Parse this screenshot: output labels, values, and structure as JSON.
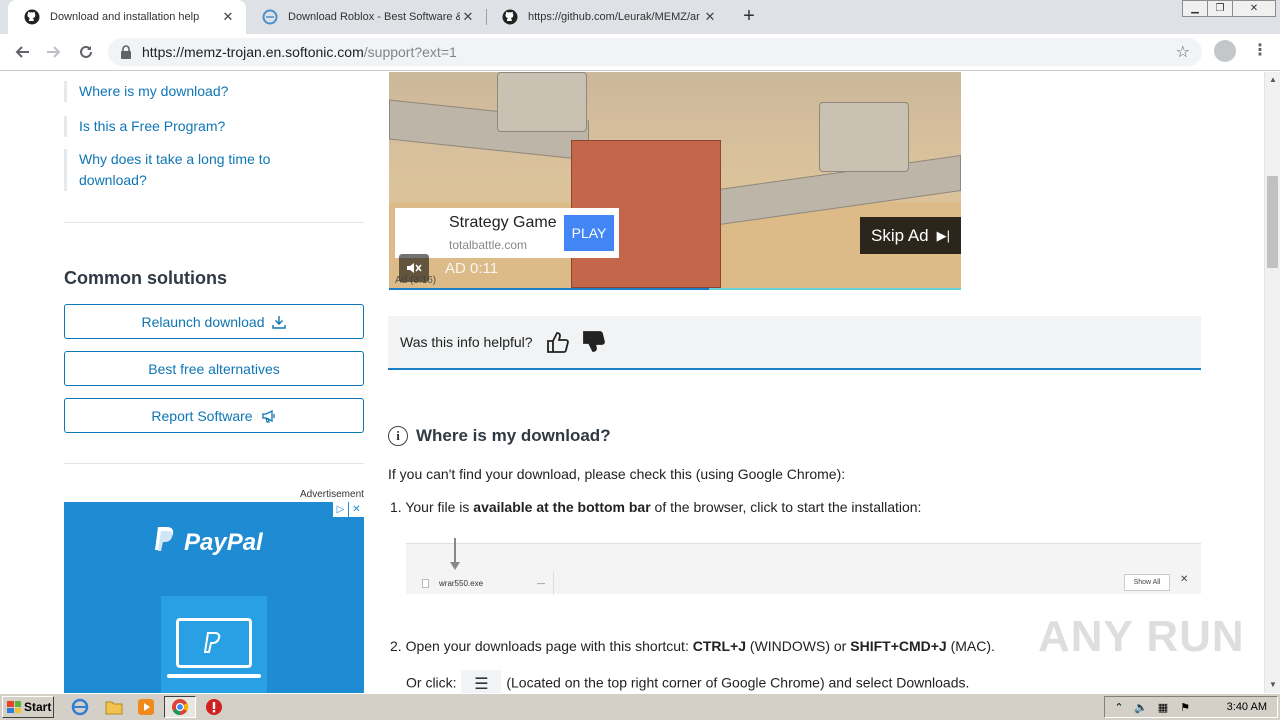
{
  "browser": {
    "tabs": [
      {
        "title": "Download and installation help",
        "icon": "github-icon",
        "active": true
      },
      {
        "title": "Download Roblox - Best Software &",
        "icon": "softonic-icon",
        "active": false
      },
      {
        "title": "https://github.com/Leurak/MEMZ/ar",
        "icon": "github-icon",
        "active": false
      }
    ],
    "url_host": "https://memz-trojan.en.softonic.com",
    "url_path": "/support?ext=1"
  },
  "sidebar": {
    "links": [
      "Where is my download?",
      "Is this a Free Program?",
      "Why does it take a long time to download?"
    ],
    "common_title": "Common solutions",
    "buttons": [
      "Relaunch download",
      "Best free alternatives",
      "Report Software"
    ],
    "advertisement_label": "Advertisement",
    "paypal_ad": {
      "brand": "PayPal",
      "adchoice_1": "▷",
      "adchoice_2": "✕"
    }
  },
  "video_ad": {
    "card_title": "Strategy Game",
    "card_domain": "totalbattle.com",
    "play_label": "PLAY",
    "skip_label": "Skip Ad",
    "timer": "AD 0:11",
    "count": "Ad (3:16)",
    "progress": 0.56
  },
  "feedback": {
    "question": "Was this info helpful?"
  },
  "main": {
    "section_title": "Where is my download?",
    "intro": "If you can't find your download, please check this (using Google Chrome):",
    "step1_prefix": "1. Your file is ",
    "step1_bold": "available at the bottom bar",
    "step1_suffix": " of the browser, click to start the installation:",
    "download_bar": {
      "filename": "wrar550.exe",
      "show_all": "Show All"
    },
    "step2_prefix": "2. Open your downloads page with this shortcut: ",
    "step2_bold1": "CTRL+J",
    "step2_mid": " (WINDOWS) or ",
    "step2_bold2": "SHIFT+CMD+J",
    "step2_suffix": " (MAC).",
    "step2b_prefix": "Or click:",
    "step2b_suffix": "(Located on the top right corner of Google Chrome) and select Downloads."
  },
  "watermark": "ANY RUN",
  "taskbar": {
    "start_label": "Start",
    "clock": "3:40 AM"
  }
}
